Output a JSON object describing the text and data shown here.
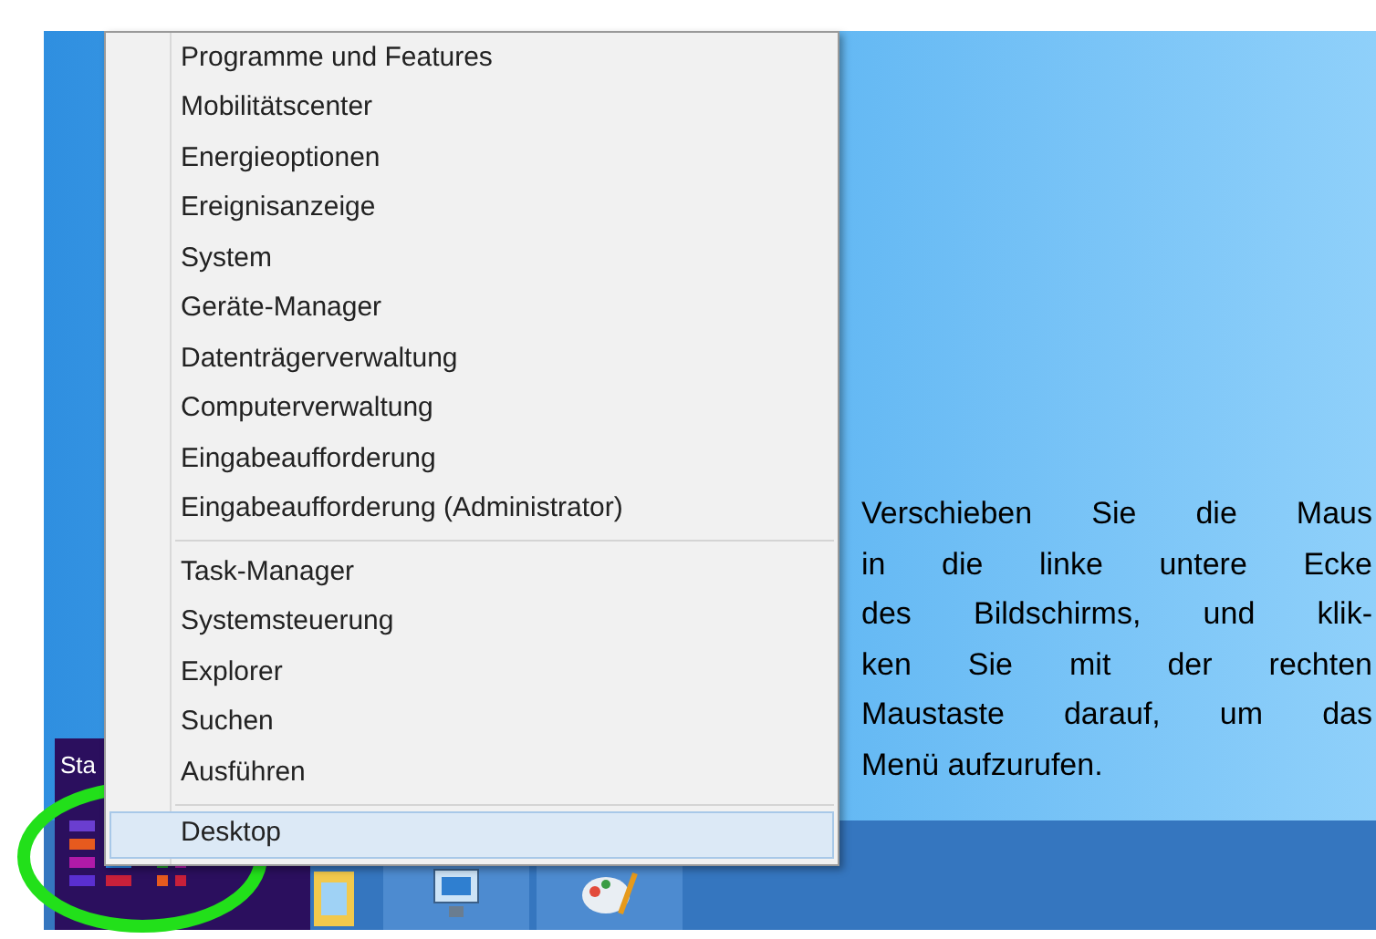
{
  "context_menu": {
    "groups": [
      [
        {
          "label": "Programme und Features",
          "selected": false
        },
        {
          "label": "Mobilitätscenter",
          "selected": false
        },
        {
          "label": "Energieoptionen",
          "selected": false
        },
        {
          "label": "Ereignisanzeige",
          "selected": false
        },
        {
          "label": "System",
          "selected": false
        },
        {
          "label": "Geräte-Manager",
          "selected": false
        },
        {
          "label": "Datenträgerverwaltung",
          "selected": false
        },
        {
          "label": "Computerverwaltung",
          "selected": false
        },
        {
          "label": "Eingabeaufforderung",
          "selected": false
        },
        {
          "label": "Eingabeaufforderung (Administrator)",
          "selected": false
        }
      ],
      [
        {
          "label": "Task-Manager",
          "selected": false
        },
        {
          "label": "Systemsteuerung",
          "selected": false
        },
        {
          "label": "Explorer",
          "selected": false
        },
        {
          "label": "Suchen",
          "selected": false
        },
        {
          "label": "Ausführen",
          "selected": false
        }
      ],
      [
        {
          "label": "Desktop",
          "selected": true
        }
      ]
    ]
  },
  "start_tile": {
    "label": "Sta"
  },
  "instruction": {
    "lines": [
      "Verschieben Sie die Maus",
      "in die linke untere Ecke",
      "des Bildschirms, und klik-",
      "ken Sie mit der rechten",
      "Maustaste darauf, um das",
      "Menü aufzurufen."
    ]
  }
}
